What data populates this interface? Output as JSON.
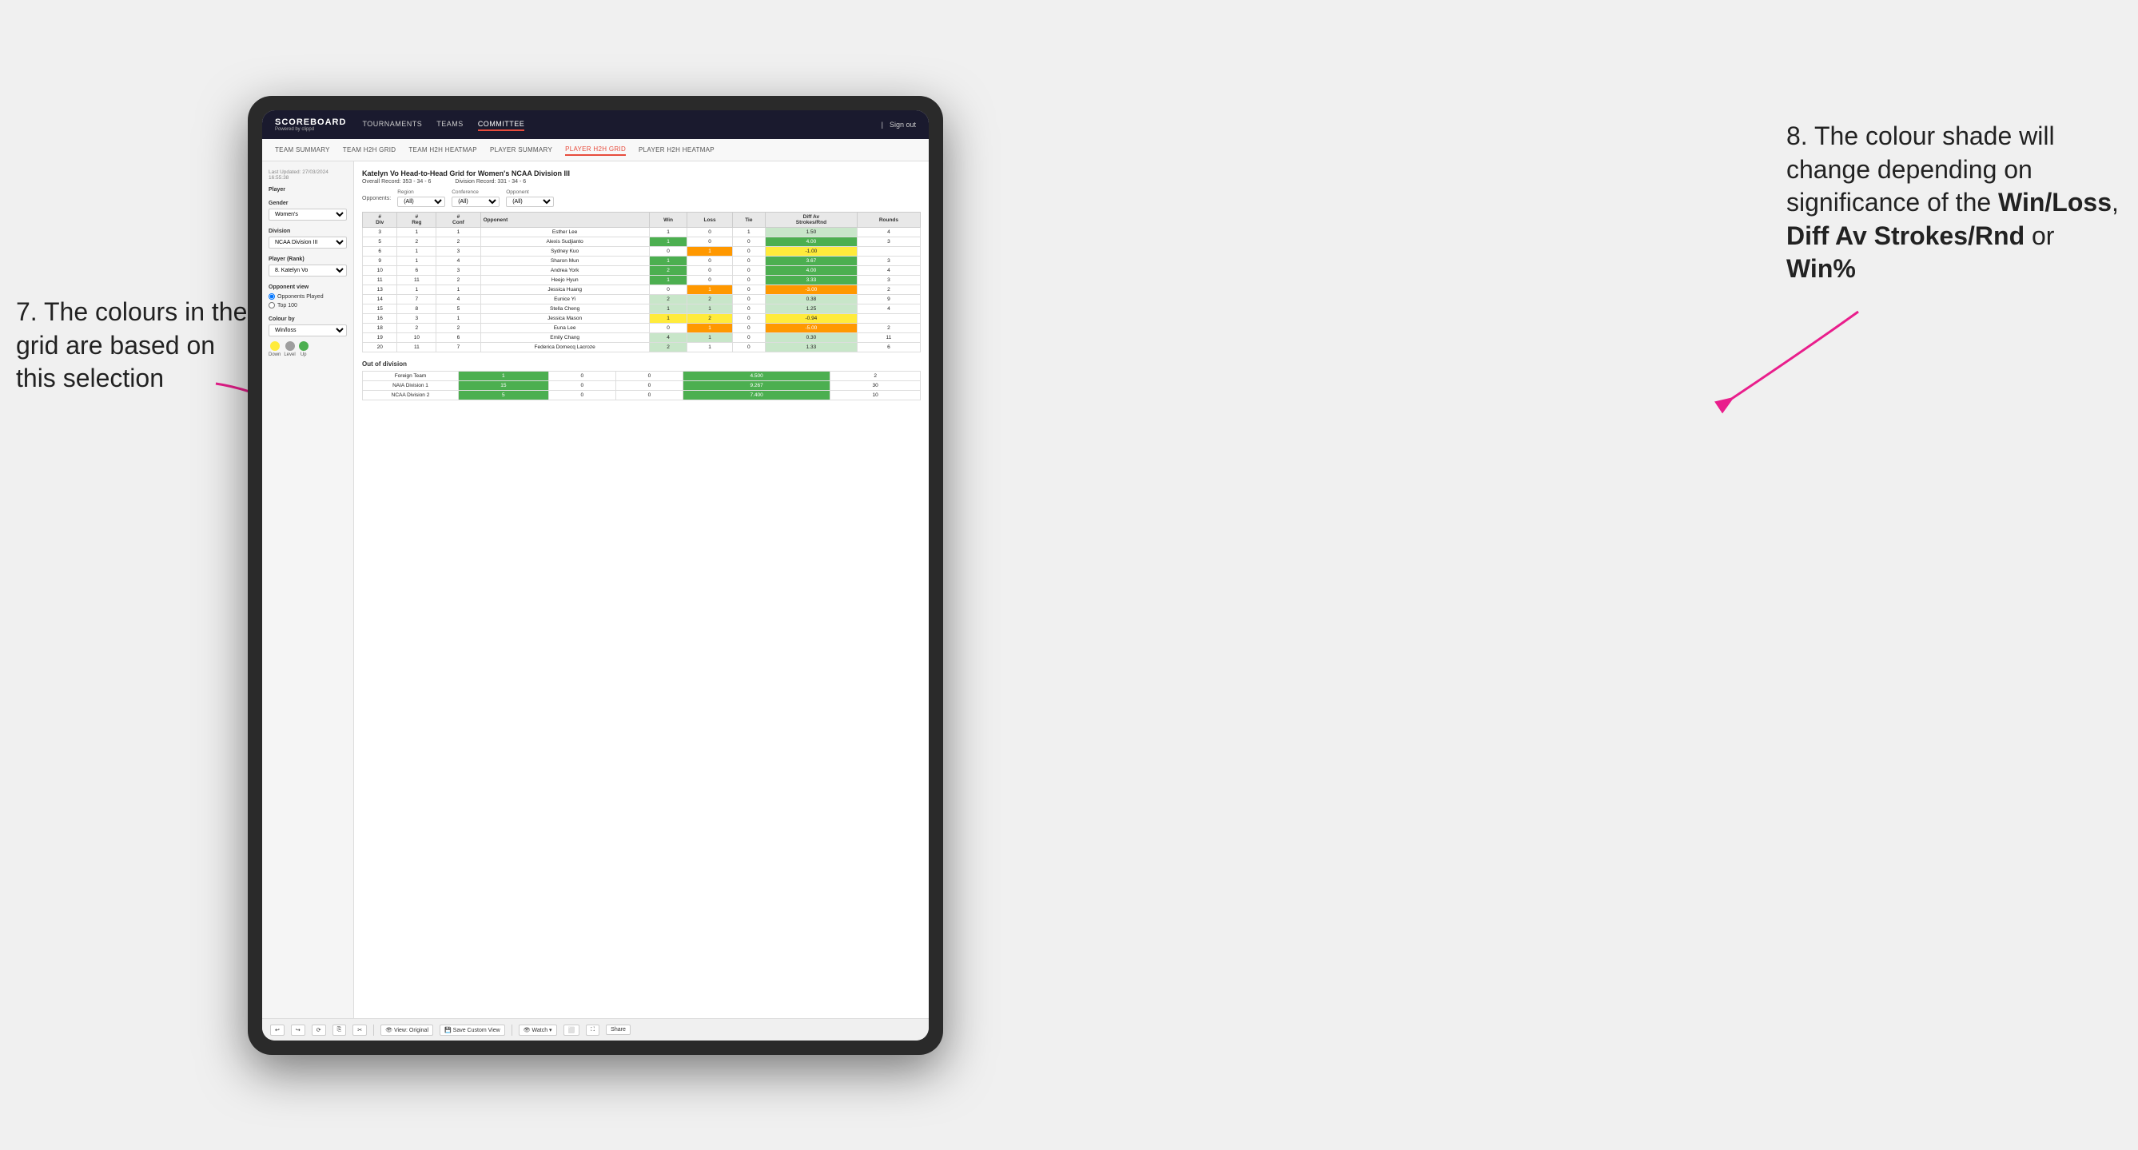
{
  "annotations": {
    "left_text": "7. The colours in the grid are based on this selection",
    "right_text_1": "8. The colour shade will change depending on significance of the ",
    "right_bold_1": "Win/Loss",
    "right_text_2": ", ",
    "right_bold_2": "Diff Av Strokes/Rnd",
    "right_text_3": " or ",
    "right_bold_3": "Win%"
  },
  "nav": {
    "logo": "SCOREBOARD",
    "logo_sub": "Powered by clippd",
    "items": [
      "TOURNAMENTS",
      "TEAMS",
      "COMMITTEE"
    ],
    "active": "COMMITTEE",
    "right": [
      "Sign out"
    ]
  },
  "sub_nav": {
    "items": [
      "TEAM SUMMARY",
      "TEAM H2H GRID",
      "TEAM H2H HEATMAP",
      "PLAYER SUMMARY",
      "PLAYER H2H GRID",
      "PLAYER H2H HEATMAP"
    ],
    "active": "PLAYER H2H GRID"
  },
  "sidebar": {
    "meta": "Last Updated: 27/03/2024 16:55:38",
    "player_label": "Player",
    "gender_label": "Gender",
    "gender_value": "Women's",
    "division_label": "Division",
    "division_value": "NCAA Division III",
    "player_rank_label": "Player (Rank)",
    "player_rank_value": "8. Katelyn Vo",
    "opponent_view_label": "Opponent view",
    "opponent_options": [
      "Opponents Played",
      "Top 100"
    ],
    "opponent_selected": "Opponents Played",
    "colour_label": "Colour by",
    "colour_value": "Win/loss",
    "legend_items": [
      {
        "label": "Down",
        "color": "#ffeb3b"
      },
      {
        "label": "Level",
        "color": "#9e9e9e"
      },
      {
        "label": "Up",
        "color": "#4caf50"
      }
    ]
  },
  "grid": {
    "title": "Katelyn Vo Head-to-Head Grid for Women's NCAA Division III",
    "overall_record_label": "Overall Record:",
    "overall_record": "353 - 34 - 6",
    "division_record_label": "Division Record:",
    "division_record": "331 - 34 - 6",
    "filters": {
      "opponents_label": "Opponents:",
      "region_label": "Region",
      "region_value": "(All)",
      "conference_label": "Conference",
      "conference_value": "(All)",
      "opponent_label": "Opponent",
      "opponent_value": "(All)"
    },
    "columns": [
      "#\nDiv",
      "#\nReg",
      "#\nConf",
      "Opponent",
      "Win",
      "Loss",
      "Tie",
      "Diff Av\nStrokes/Rnd",
      "Rounds"
    ],
    "rows": [
      {
        "div": 3,
        "reg": 1,
        "conf": 1,
        "opponent": "Esther Lee",
        "win": 1,
        "loss": 0,
        "tie": 1,
        "diff": "1.50",
        "rounds": 4,
        "win_color": "neutral",
        "loss_color": "neutral"
      },
      {
        "div": 5,
        "reg": 2,
        "conf": 2,
        "opponent": "Alexis Sudjianto",
        "win": 1,
        "loss": 0,
        "tie": 0,
        "diff": "4.00",
        "rounds": 3,
        "win_color": "green",
        "loss_color": "neutral"
      },
      {
        "div": 6,
        "reg": 1,
        "conf": 3,
        "opponent": "Sydney Kuo",
        "win": 0,
        "loss": 1,
        "tie": 0,
        "diff": "-1.00",
        "rounds": "",
        "win_color": "neutral",
        "loss_color": "orange"
      },
      {
        "div": 9,
        "reg": 1,
        "conf": 4,
        "opponent": "Sharon Mun",
        "win": 1,
        "loss": 0,
        "tie": 0,
        "diff": "3.67",
        "rounds": 3,
        "win_color": "green",
        "loss_color": "neutral"
      },
      {
        "div": 10,
        "reg": 6,
        "conf": 3,
        "opponent": "Andrea York",
        "win": 2,
        "loss": 0,
        "tie": 0,
        "diff": "4.00",
        "rounds": 4,
        "win_color": "green",
        "loss_color": "neutral"
      },
      {
        "div": 11,
        "reg": 11,
        "conf": 2,
        "opponent": "Heejo Hyun",
        "win": 1,
        "loss": 0,
        "tie": 0,
        "diff": "3.33",
        "rounds": 3,
        "win_color": "green",
        "loss_color": "neutral"
      },
      {
        "div": 13,
        "reg": 1,
        "conf": 1,
        "opponent": "Jessica Huang",
        "win": 0,
        "loss": 1,
        "tie": 0,
        "diff": "-3.00",
        "rounds": 2,
        "win_color": "neutral",
        "loss_color": "orange"
      },
      {
        "div": 14,
        "reg": 7,
        "conf": 4,
        "opponent": "Eunice Yi",
        "win": 2,
        "loss": 2,
        "tie": 0,
        "diff": "0.38",
        "rounds": 9,
        "win_color": "light-green",
        "loss_color": "light-green"
      },
      {
        "div": 15,
        "reg": 8,
        "conf": 5,
        "opponent": "Stella Cheng",
        "win": 1,
        "loss": 1,
        "tie": 0,
        "diff": "1.25",
        "rounds": 4,
        "win_color": "light-green",
        "loss_color": "light-green"
      },
      {
        "div": 16,
        "reg": 3,
        "conf": 1,
        "opponent": "Jessica Mason",
        "win": 1,
        "loss": 2,
        "tie": 0,
        "diff": "-0.94",
        "rounds": "",
        "win_color": "yellow",
        "loss_color": "yellow"
      },
      {
        "div": 18,
        "reg": 2,
        "conf": 2,
        "opponent": "Euna Lee",
        "win": 0,
        "loss": 1,
        "tie": 0,
        "diff": "-5.00",
        "rounds": 2,
        "win_color": "neutral",
        "loss_color": "orange"
      },
      {
        "div": 19,
        "reg": 10,
        "conf": 6,
        "opponent": "Emily Chang",
        "win": 4,
        "loss": 1,
        "tie": 0,
        "diff": "0.30",
        "rounds": 11,
        "win_color": "light-green",
        "loss_color": "light-green"
      },
      {
        "div": 20,
        "reg": 11,
        "conf": 7,
        "opponent": "Federica Domecq Lacroze",
        "win": 2,
        "loss": 1,
        "tie": 0,
        "diff": "1.33",
        "rounds": 6,
        "win_color": "light-green",
        "loss_color": "neutral"
      }
    ],
    "out_of_division_label": "Out of division",
    "out_of_division_rows": [
      {
        "opponent": "Foreign Team",
        "win": 1,
        "loss": 0,
        "tie": 0,
        "diff": "4.500",
        "rounds": 2
      },
      {
        "opponent": "NAIA Division 1",
        "win": 15,
        "loss": 0,
        "tie": 0,
        "diff": "9.267",
        "rounds": 30
      },
      {
        "opponent": "NCAA Division 2",
        "win": 5,
        "loss": 0,
        "tie": 0,
        "diff": "7.400",
        "rounds": 10
      }
    ]
  },
  "toolbar": {
    "buttons": [
      "↩",
      "↪",
      "⟳",
      "⎘",
      "✂",
      "◊",
      "⟲",
      "|",
      "👁 View: Original",
      "💾 Save Custom View",
      "👁 Watch ▾",
      "⬜",
      "⛶",
      "Share"
    ]
  }
}
